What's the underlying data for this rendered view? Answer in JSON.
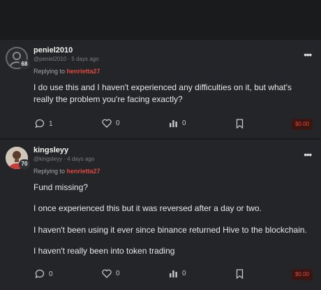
{
  "posts": [
    {
      "author": "peniel2010",
      "handle": "@peniel2010",
      "time": "5 days ago",
      "reputation": "68",
      "replying_label": "Replying to",
      "replying_to": "henrietta27",
      "paragraphs": [
        "I do use this and I haven't experienced any difficulties on it, but what's",
        "really the problem you're facing exactly?"
      ],
      "comments": "1",
      "votes": "0",
      "stats": "0",
      "payout": "$0.00"
    },
    {
      "author": "kingsleyy",
      "handle": "@kingsleyy",
      "time": "4 days ago",
      "reputation": "70",
      "replying_label": "Replying to",
      "replying_to": "henrietta27",
      "paragraphs": [
        "Fund missing?",
        "I once experienced this but it was reversed after a day or two.",
        "I haven't been using it ever since binance returned Hive to the blockchain.",
        "I haven't really been into token trading"
      ],
      "comments": "0",
      "votes": "0",
      "stats": "0",
      "payout": "$0.00"
    }
  ],
  "icons": {
    "more": "more-icon",
    "comment": "comment-icon",
    "vote": "heart-icon",
    "stats": "bar-chart-icon",
    "bookmark": "bookmark-icon"
  },
  "colors": {
    "accent": "#e2483d",
    "background": "#242528"
  }
}
